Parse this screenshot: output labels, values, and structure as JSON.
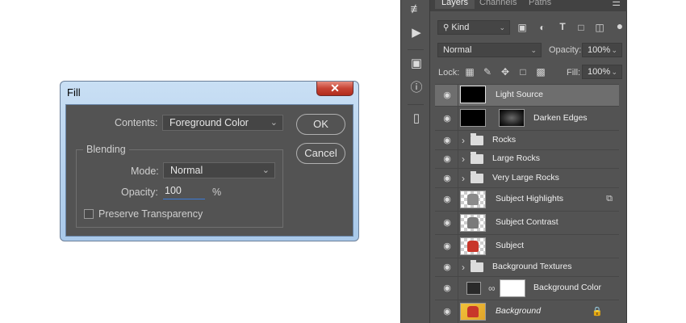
{
  "fill_dialog": {
    "title": "Fill",
    "close_label": "✕",
    "contents_label": "Contents:",
    "contents_value": "Foreground Color",
    "ok_label": "OK",
    "cancel_label": "Cancel",
    "blending_label": "Blending",
    "mode_label": "Mode:",
    "mode_value": "Normal",
    "opacity_label": "Opacity:",
    "opacity_value": "100",
    "opacity_unit": "%",
    "preserve_label": "Preserve Transparency",
    "preserve_checked": false
  },
  "toolstrip": {
    "icons": [
      "history-icon",
      "play-actions-icon",
      "3d-cube-icon",
      "info-icon",
      "clone-source-icon"
    ]
  },
  "layers_panel": {
    "tabs": [
      "Layers",
      "Channels",
      "Paths"
    ],
    "active_tab": "Layers",
    "kind_label": "Kind",
    "blend_mode": "Normal",
    "opacity_label": "Opacity:",
    "opacity_value": "100%",
    "lock_label": "Lock:",
    "fill_label": "Fill:",
    "fill_value": "100%",
    "layers": [
      {
        "name": "Light Source",
        "type": "layer",
        "thumb": "black",
        "selected": true
      },
      {
        "name": "Darken Edges",
        "type": "layer-with-mask",
        "thumb": "black",
        "mask": "mask"
      },
      {
        "name": "Rocks",
        "type": "group"
      },
      {
        "name": "Large Rocks",
        "type": "group"
      },
      {
        "name": "Very Large Rocks",
        "type": "group"
      },
      {
        "name": "Subject Highlights",
        "type": "layer",
        "thumb": "checker",
        "badge": "smart-object-icon"
      },
      {
        "name": "Subject Contrast",
        "type": "layer",
        "thumb": "checker"
      },
      {
        "name": "Subject",
        "type": "layer",
        "thumb": "checker-red"
      },
      {
        "name": "Background Textures",
        "type": "group"
      },
      {
        "name": "Background Color",
        "type": "fill-layer",
        "thumb": "dark",
        "mask": "white"
      },
      {
        "name": "Background",
        "type": "background",
        "thumb": "bg",
        "italic": true,
        "badge": "lock-icon"
      }
    ]
  },
  "colors": {
    "panel_bg": "#535353",
    "selected_row": "#6e6e6e",
    "dialog_frame": "#b6d2ee",
    "close_red": "#c74434",
    "input_focus": "#3b7bd8"
  }
}
